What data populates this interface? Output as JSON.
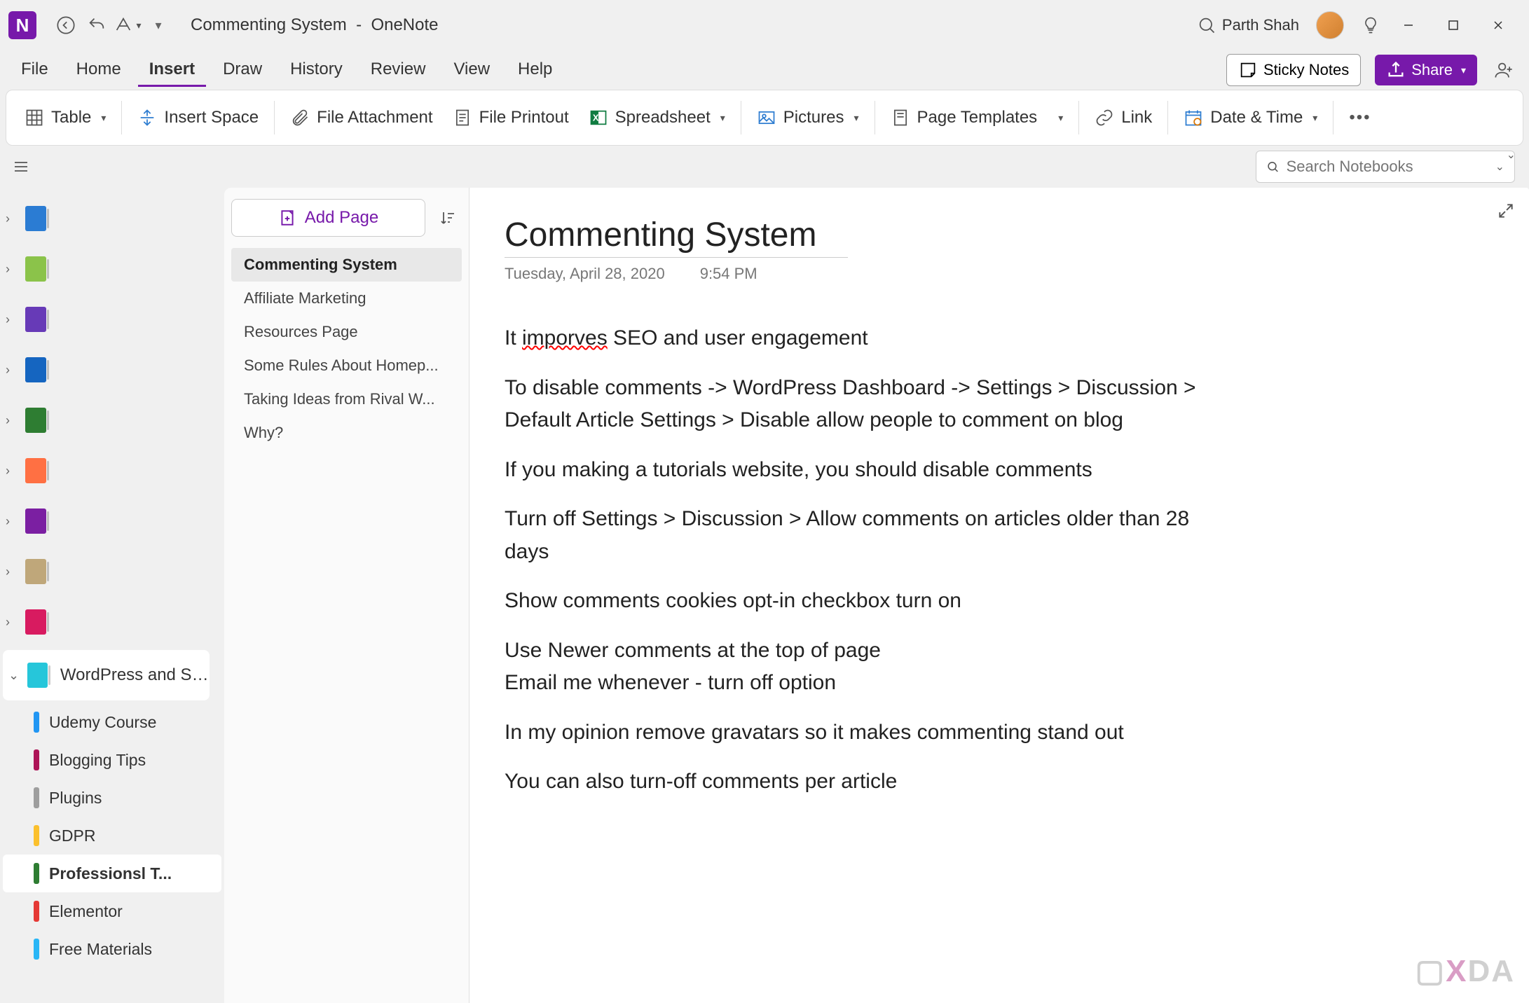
{
  "titlebar": {
    "app_letter": "N",
    "doc_title": "Commenting System",
    "separator": "-",
    "app_name": "OneNote",
    "user_name": "Parth Shah"
  },
  "menu": {
    "items": [
      "File",
      "Home",
      "Insert",
      "Draw",
      "History",
      "Review",
      "View",
      "Help"
    ],
    "active_index": 2,
    "sticky_notes": "Sticky Notes",
    "share": "Share"
  },
  "ribbon": {
    "table": "Table",
    "insert_space": "Insert Space",
    "file_attachment": "File Attachment",
    "file_printout": "File Printout",
    "spreadsheet": "Spreadsheet",
    "pictures": "Pictures",
    "page_templates": "Page Templates",
    "link": "Link",
    "date_time": "Date & Time"
  },
  "search": {
    "placeholder": "Search Notebooks"
  },
  "notebooks": {
    "closed": [
      {
        "color": "#2b7cd3"
      },
      {
        "color": "#8bc34a"
      },
      {
        "color": "#673ab7"
      },
      {
        "color": "#1565c0"
      },
      {
        "color": "#2e7d32"
      },
      {
        "color": "#ff7043"
      },
      {
        "color": "#7b1fa2"
      },
      {
        "color": "#bfa77a"
      },
      {
        "color": "#d81b60"
      }
    ],
    "expanded": {
      "color": "#26c6da",
      "label": "WordPress and SEO",
      "sections": [
        {
          "color": "#2196f3",
          "label": "Udemy Course",
          "active": false
        },
        {
          "color": "#ad1457",
          "label": "Blogging Tips",
          "active": false
        },
        {
          "color": "#9e9e9e",
          "label": "Plugins",
          "active": false
        },
        {
          "color": "#fbc02d",
          "label": "GDPR",
          "active": false
        },
        {
          "color": "#2e7d32",
          "label": "Professionsl T...",
          "active": true
        },
        {
          "color": "#e53935",
          "label": "Elementor",
          "active": false
        },
        {
          "color": "#29b6f6",
          "label": "Free Materials",
          "active": false
        }
      ]
    }
  },
  "pages": {
    "add_label": "Add Page",
    "items": [
      {
        "label": "Commenting System",
        "active": true
      },
      {
        "label": "Affiliate Marketing",
        "active": false
      },
      {
        "label": "Resources Page",
        "active": false
      },
      {
        "label": "Some Rules About Homep...",
        "active": false
      },
      {
        "label": "Taking Ideas from Rival W...",
        "active": false
      },
      {
        "label": "Why?",
        "active": false
      }
    ]
  },
  "content": {
    "title": "Commenting System",
    "date": "Tuesday, April 28, 2020",
    "time": "9:54 PM",
    "body": {
      "p1a": "It ",
      "p1_spell": "imporves",
      "p1b": " SEO and user engagement",
      "p2": "To disable comments -> WordPress Dashboard -> Settings > Discussion > Default Article Settings > Disable allow people to comment on blog",
      "p3": "If you making a tutorials website, you should disable comments",
      "p4": "Turn off Settings > Discussion > Allow comments on articles older than 28 days",
      "p5": "Show comments cookies opt-in checkbox turn on",
      "p6": "Use Newer comments at the top of page\nEmail me whenever - turn off option",
      "p7": "In my opinion remove gravatars so it makes commenting stand out",
      "p8": "You can also turn-off comments per article"
    }
  }
}
